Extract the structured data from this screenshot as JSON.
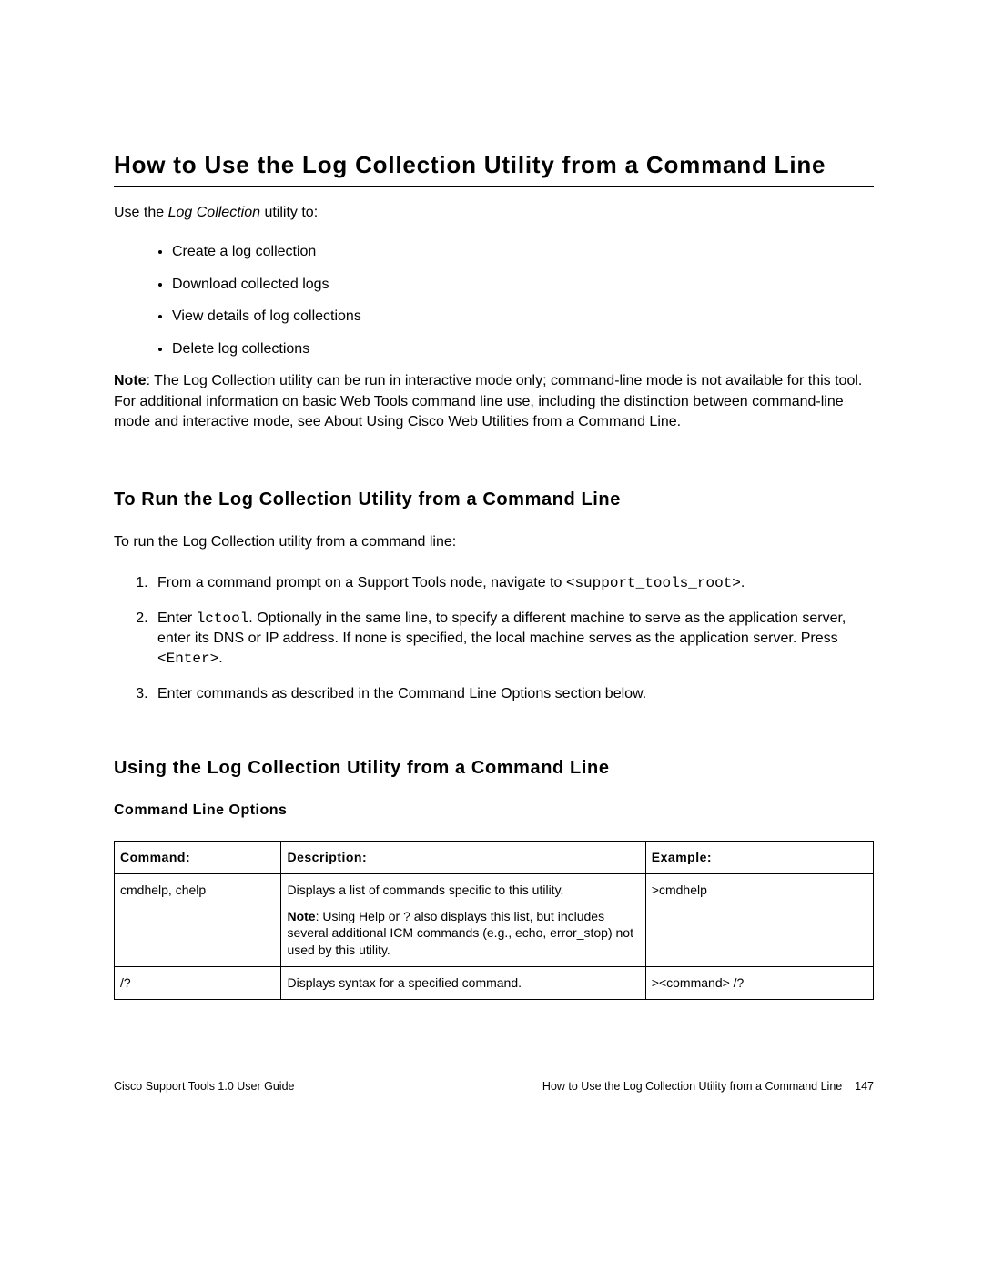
{
  "title": "How to Use the Log Collection Utility from a Command Line",
  "intro_prefix": "Use the ",
  "intro_italic": "Log Collection",
  "intro_suffix": " utility to:",
  "bullets": [
    "Create a log collection",
    "Download collected logs",
    "View details of log collections",
    "Delete log collections"
  ],
  "note_label": "Note",
  "note_body": ": The Log Collection utility can be run in interactive mode only; command-line mode is not available for this tool. For additional information on basic Web Tools command line use, including the distinction between command-line mode and interactive mode, see About Using Cisco Web Utilities from a Command Line.",
  "section_run_heading": "To Run the Log Collection Utility from a Command Line",
  "run_intro": "To run the Log Collection utility from a command line:",
  "steps": {
    "s1_a": "From a command prompt on a Support Tools node, navigate to ",
    "s1_code": "<support_tools_root>",
    "s1_b": ".",
    "s2_a": "Enter ",
    "s2_code1": "lctool",
    "s2_b": ". Optionally in the same line, to specify a different machine to serve as the application server, enter its DNS or IP address. If none is specified, the local machine serves as the application server. Press ",
    "s2_code2": "<Enter>",
    "s2_c": ".",
    "s3": "Enter commands as described in the Command Line Options section below."
  },
  "section_use_heading": "Using the Log Collection Utility from a Command Line",
  "table_caption": "Command Line Options",
  "table": {
    "headers": {
      "cmd": "Command:",
      "desc": "Description:",
      "ex": "Example:"
    },
    "rows": [
      {
        "cmd": "cmdhelp, chelp",
        "desc_main": "Displays a list of commands specific to this utility.",
        "desc_note_label": "Note",
        "desc_note": ": Using Help or ? also displays this list, but includes several additional ICM commands (e.g., echo, error_stop) not used by this utility.",
        "ex": ">cmdhelp"
      },
      {
        "cmd": "/?",
        "desc_main": "Displays syntax for a specified command.",
        "desc_note_label": "",
        "desc_note": "",
        "ex": "><command> /?"
      }
    ]
  },
  "footer": {
    "left": "Cisco Support Tools 1.0 User Guide",
    "right_title": "How to Use the Log Collection Utility from a Command Line",
    "page_num": "147"
  }
}
